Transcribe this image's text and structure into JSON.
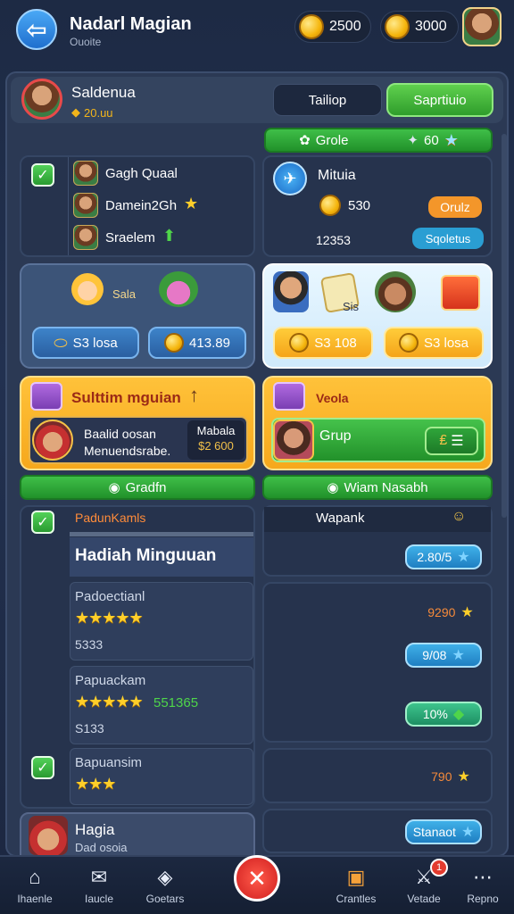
{
  "header": {
    "title": "Nadarl Magian",
    "subtitle": "Ouoite",
    "currency_a": "2500",
    "currency_b": "3000"
  },
  "profile": {
    "name": "Saldenua",
    "coins": "20.uu",
    "tab_inactive": "Tailiop",
    "tab_active": "Saprtiuio"
  },
  "top_bar": {
    "label": "Grole",
    "value": "60"
  },
  "friends": [
    {
      "name": "Gagh Quaal",
      "badge": ""
    },
    {
      "name": "Damein2Gh",
      "badge": "star"
    },
    {
      "name": "Sraelem",
      "badge": "arrow"
    }
  ],
  "mission_card": {
    "title": "Mituia",
    "coins": "530",
    "button": "Orulz",
    "value": "12353",
    "button2": "Sqoletus"
  },
  "reward_left": {
    "label": "Sala",
    "pill_a": "S3 losa",
    "pill_b": "413.89"
  },
  "reward_right": {
    "label": "Sis",
    "pill_a": "S3 108",
    "pill_b": "S3 losa"
  },
  "promo_left": {
    "title": "Sulttim mguian",
    "line1": "Baalid oosan",
    "line2": "Menuendsrabe.",
    "box_label": "Mabala",
    "box_value": "$2 600"
  },
  "promo_right": {
    "title": "Veola",
    "label": "Grup"
  },
  "bars": {
    "left": "Gradfn",
    "right": "Wiam Nasabh"
  },
  "weekly": {
    "header": "PadunKamls",
    "title": "Hadiah Minguuan",
    "items": [
      {
        "name": "Padoectianl",
        "value": "5333",
        "stars": "★★★★★",
        "extra": ""
      },
      {
        "name": "Papuackam",
        "value": "S133",
        "stars": "★★★★★",
        "extra": "551365"
      },
      {
        "name": "Bapuansim",
        "value": "",
        "stars": "★★★",
        "extra": ""
      }
    ]
  },
  "ranking": {
    "header": "Wapank",
    "rows": [
      {
        "value": "2.80/5",
        "kind": "blue"
      },
      {
        "value": "9290",
        "kind": "plain"
      },
      {
        "value": "9/08",
        "kind": "blue"
      },
      {
        "value": "10%",
        "kind": "green"
      },
      {
        "value": "790",
        "kind": "plain"
      },
      {
        "value": "Stanaot",
        "kind": "blue"
      }
    ]
  },
  "bottom_card": {
    "name": "Hagia",
    "sub": "Dad osoia"
  },
  "nav": {
    "items": [
      "Ihaenle",
      "Iaucle",
      "Goetars",
      "Crantles",
      "Vetade",
      "Repno"
    ],
    "badge": "1"
  }
}
